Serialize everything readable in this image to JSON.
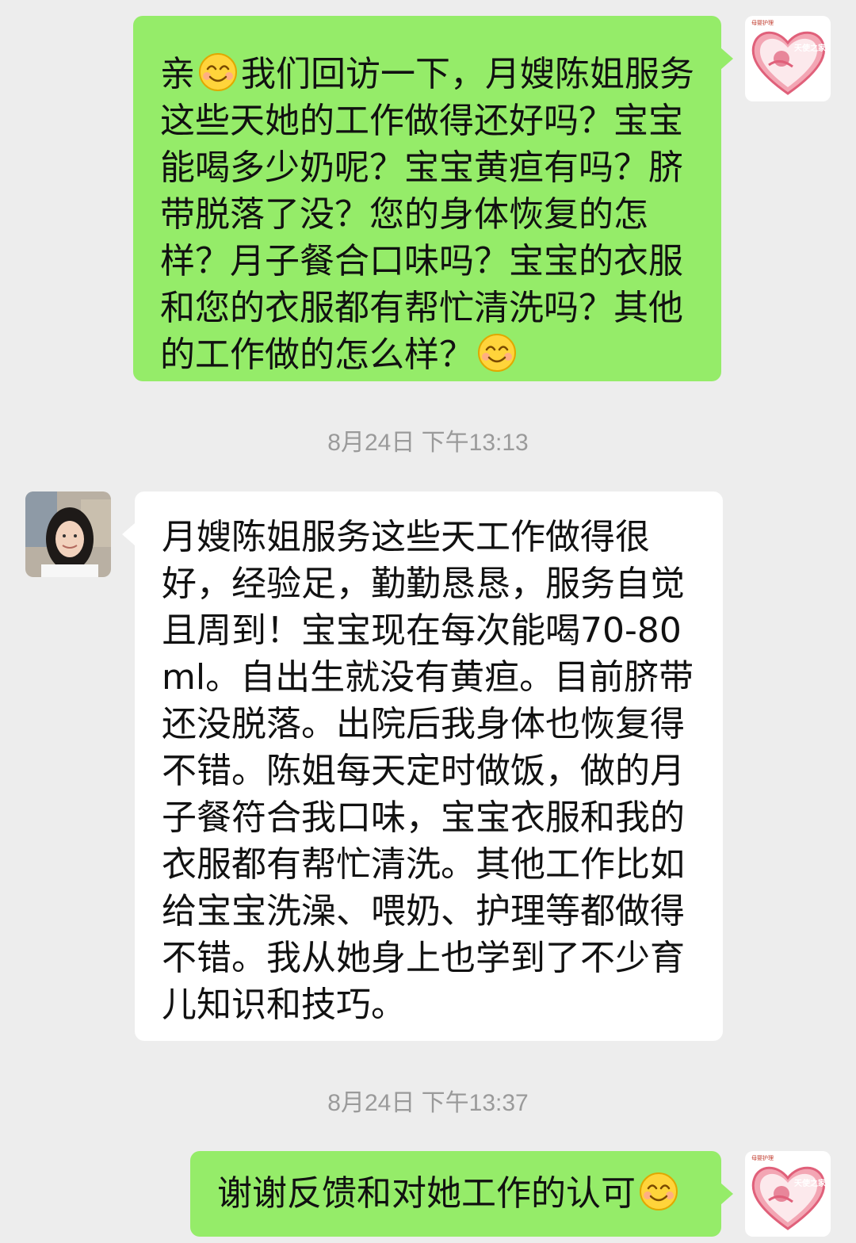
{
  "colors": {
    "background": "#ededed",
    "outgoing_bubble": "#95ec69",
    "incoming_bubble": "#ffffff",
    "timestamp_text": "#9a9a9a"
  },
  "messages": [
    {
      "direction": "outgoing",
      "parts": [
        "亲",
        "我们回访一下，月嫂陈姐服务这些天她的工作做得还好吗？宝宝能喝多少奶呢？宝宝黄疸有吗？脐带脱落了没？您的身体恢复的怎样？月子餐合口味吗？宝宝的衣服和您的衣服都有帮忙清洗吗？其他的工作做的怎么样？"
      ],
      "emoji": "smile-emoji"
    },
    {
      "direction": "incoming",
      "text": "月嫂陈姐服务这些天工作做得很好，经验足，勤勤恳恳，服务自觉且周到！宝宝现在每次能喝70-80ml。自出生就没有黄疸。目前脐带还没脱落。出院后我身体也恢复得不错。陈姐每天定时做饭，做的月子餐符合我口味，宝宝衣服和我的衣服都有帮忙清洗。其他工作比如给宝宝洗澡、喂奶、护理等都做得不错。我从她身上也学到了不少育儿知识和技巧。"
    },
    {
      "direction": "outgoing",
      "text": "谢谢反馈和对她工作的认可",
      "emoji": "smile-emoji"
    }
  ],
  "timestamps": [
    "8月24日 下午13:13",
    "8月24日 下午13:37"
  ],
  "logo": {
    "caption": "母婴护理",
    "text": "天使之家"
  }
}
